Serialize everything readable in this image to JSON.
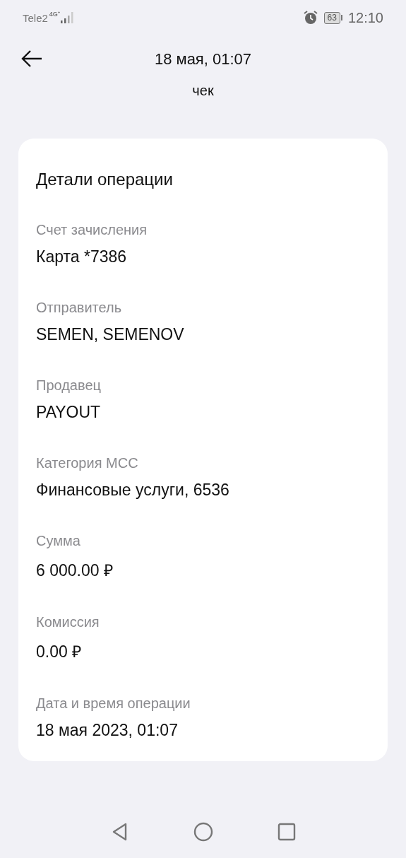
{
  "status_bar": {
    "carrier": "Tele2",
    "network": "4G⁺",
    "battery": "63",
    "time": "12:10"
  },
  "header": {
    "title": "18 мая, 01:07"
  },
  "receipt_action": {
    "label": "чек"
  },
  "details": {
    "title": "Детали операции",
    "fields": [
      {
        "label": "Счет зачисления",
        "value": "Карта *7386"
      },
      {
        "label": "Отправитель",
        "value": "SEMEN, SEMENOV"
      },
      {
        "label": "Продавец",
        "value": "PAYOUT"
      },
      {
        "label": "Категория MCC",
        "value": "Финансовые услуги, 6536"
      },
      {
        "label": "Сумма",
        "value": "6 000.00 ₽"
      },
      {
        "label": "Комиссия",
        "value": "0.00 ₽"
      },
      {
        "label": "Дата и время операции",
        "value": "18 мая 2023, 01:07"
      }
    ]
  }
}
